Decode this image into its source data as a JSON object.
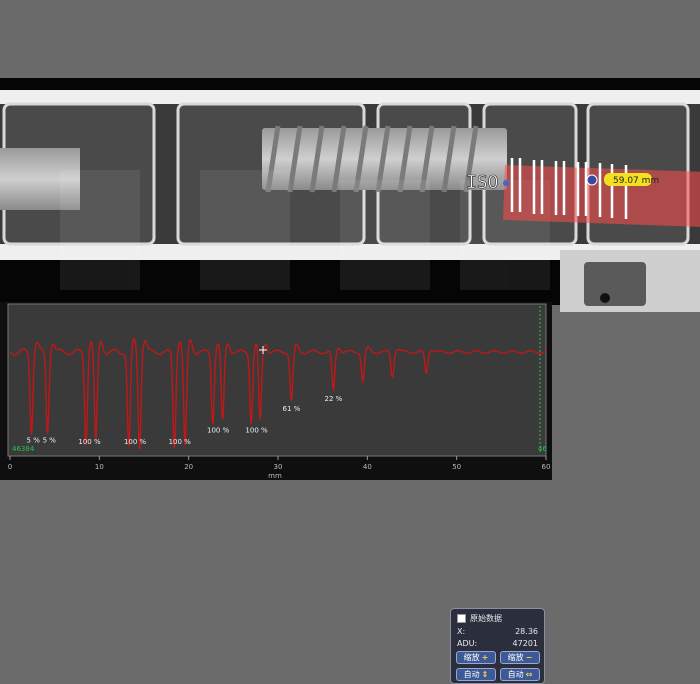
{
  "measurement": {
    "label": "ISO",
    "value": "59.07 mm",
    "value_badge_color": "#f2e11e",
    "line_color": "#ff4d4d"
  },
  "panel": {
    "title": "原始数据",
    "x_label": "X:",
    "x_value": "28.36",
    "adu_label": "ADU:",
    "adu_value": "47201",
    "zoom_in_label": "缩放",
    "zoom_out_label": "缩放",
    "auto_v_label": "自动",
    "auto_h_label": "自动",
    "icons": [
      "plus-icon",
      "minus-icon",
      "vertical-arrows-icon",
      "horizontal-arrows-icon"
    ]
  },
  "chart_data": {
    "type": "line",
    "xlabel": "mm",
    "xlim": [
      0,
      60
    ],
    "x_ticks": [
      "0",
      "10",
      "20",
      "30",
      "40",
      "50",
      "60"
    ],
    "y_min_label": "46384",
    "right_edge_label": "46",
    "line_color": "#c01818",
    "dips": [
      {
        "x": 2.4,
        "depth": 0.82
      },
      {
        "x": 4.2,
        "depth": 0.82
      },
      {
        "x": 8.5,
        "depth": 0.93
      },
      {
        "x": 9.6,
        "depth": 0.93
      },
      {
        "x": 13.3,
        "depth": 0.98
      },
      {
        "x": 14.5,
        "depth": 0.98
      },
      {
        "x": 18.4,
        "depth": 0.98
      },
      {
        "x": 19.6,
        "depth": 0.98
      },
      {
        "x": 22.7,
        "depth": 0.72
      },
      {
        "x": 23.8,
        "depth": 0.72
      },
      {
        "x": 27.0,
        "depth": 0.72
      },
      {
        "x": 28.0,
        "depth": 0.72
      },
      {
        "x": 31.5,
        "depth": 0.5
      },
      {
        "x": 36.2,
        "depth": 0.4
      },
      {
        "x": 39.5,
        "depth": 0.3
      },
      {
        "x": 42.8,
        "depth": 0.25
      },
      {
        "x": 46.6,
        "depth": 0.22
      }
    ],
    "annotations": [
      {
        "x": 2.6,
        "text": "5 %"
      },
      {
        "x": 4.4,
        "text": "5 %"
      },
      {
        "x": 8.9,
        "text": "100 %"
      },
      {
        "x": 14.0,
        "text": "100 %"
      },
      {
        "x": 19.0,
        "text": "100 %"
      },
      {
        "x": 23.3,
        "text": "100 %"
      },
      {
        "x": 27.6,
        "text": "100 %"
      },
      {
        "x": 31.5,
        "text": "61 %"
      },
      {
        "x": 36.2,
        "text": "22 %"
      }
    ]
  }
}
